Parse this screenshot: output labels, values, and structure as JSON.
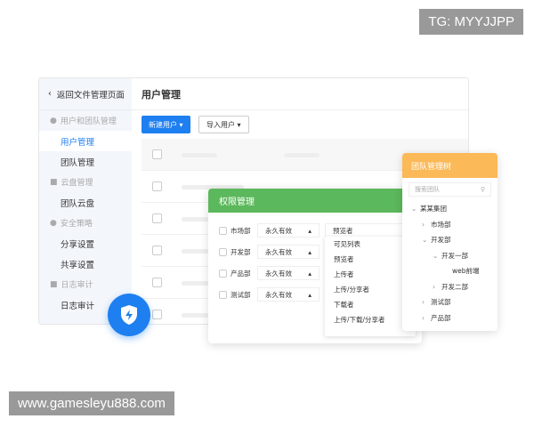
{
  "watermarks": {
    "top": "TG: MYYJJPP",
    "bottom": "www.gamesleyu888.com"
  },
  "sidebar": {
    "back": "返回文件管理页面",
    "groups": [
      {
        "label": "用户和团队管理",
        "items": [
          "用户管理",
          "团队管理"
        ]
      },
      {
        "label": "云盘管理",
        "items": [
          "团队云盘"
        ]
      },
      {
        "label": "安全策略",
        "items": [
          "分享设置",
          "共享设置"
        ]
      },
      {
        "label": "日志审计",
        "items": [
          "日志审计"
        ]
      }
    ]
  },
  "main": {
    "title": "用户管理",
    "new_user": "新建用户",
    "import_user": "导入用户"
  },
  "permission": {
    "title": "权限管理",
    "rows": [
      {
        "dept": "市场部",
        "validity": "永久有效",
        "role": "预览者"
      },
      {
        "dept": "开发部",
        "validity": "永久有效"
      },
      {
        "dept": "产品部",
        "validity": "永久有效"
      },
      {
        "dept": "测试部",
        "validity": "永久有效"
      }
    ],
    "role_options": [
      "可见列表",
      "预览者",
      "上传者",
      "上传/分享者",
      "下载者",
      "上传/下载/分享者"
    ]
  },
  "team_tree": {
    "title": "团队管理树",
    "search_placeholder": "搜索团队",
    "nodes": [
      {
        "label": "某某集团",
        "arrow": "⌄",
        "level": 0
      },
      {
        "label": "市场部",
        "arrow": "›",
        "level": 1
      },
      {
        "label": "开发部",
        "arrow": "⌄",
        "level": 1
      },
      {
        "label": "开发一部",
        "arrow": "⌄",
        "level": 2
      },
      {
        "label": "web前端",
        "arrow": "",
        "level": 3
      },
      {
        "label": "开发二部",
        "arrow": "›",
        "level": 2
      },
      {
        "label": "测试部",
        "arrow": "›",
        "level": 1
      },
      {
        "label": "产品部",
        "arrow": "›",
        "level": 1
      }
    ]
  },
  "colors": {
    "primary": "#1e7ff0",
    "permission": "#5cb85c",
    "team": "#fbb957"
  }
}
